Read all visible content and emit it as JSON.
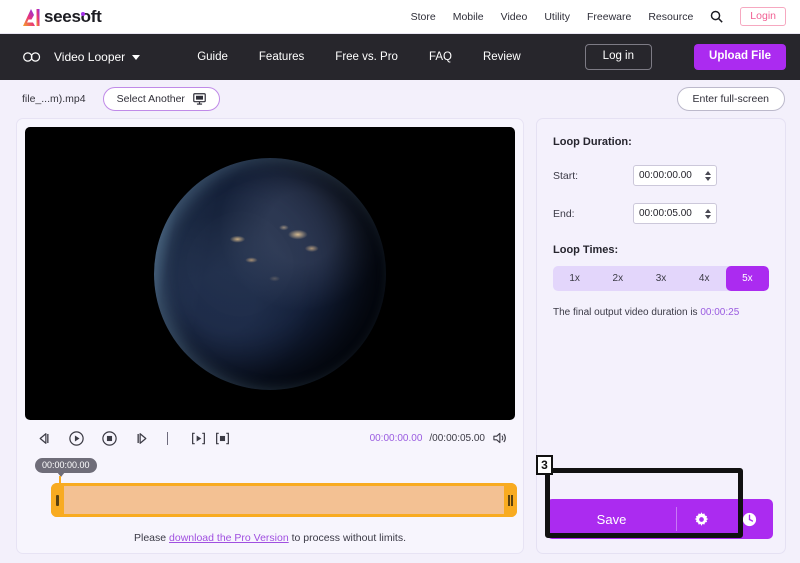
{
  "topbar": {
    "logo_text": "seesoft",
    "nav": [
      {
        "label": "Store"
      },
      {
        "label": "Mobile"
      },
      {
        "label": "Video"
      },
      {
        "label": "Utility"
      },
      {
        "label": "Freeware"
      },
      {
        "label": "Resource"
      }
    ],
    "search_icon": "search-icon",
    "login_label": "Login"
  },
  "darknav": {
    "loop_icon": "loop-icon",
    "product": "Video Looper",
    "links": [
      {
        "label": "Guide"
      },
      {
        "label": "Features"
      },
      {
        "label": "Free vs. Pro"
      },
      {
        "label": "FAQ"
      },
      {
        "label": "Review"
      }
    ],
    "login_label": "Log in",
    "upload_label": "Upload File"
  },
  "filerow": {
    "filename": "file_...m).mp4",
    "select_another_label": "Select Another",
    "monitor_icon": "monitor-icon",
    "fullscreen_label": "Enter full-screen"
  },
  "player": {
    "controls": [
      {
        "name": "rewind-button",
        "glyph": "rewind"
      },
      {
        "name": "play-button",
        "glyph": "play"
      },
      {
        "name": "stop-button",
        "glyph": "stop"
      },
      {
        "name": "fast-forward-button",
        "glyph": "forward"
      }
    ],
    "bracket_controls": [
      {
        "name": "set-start-marker-button",
        "glyph": "bracket-play"
      },
      {
        "name": "set-end-marker-button",
        "glyph": "bracket-stop"
      }
    ],
    "current_time": "00:00:00.00",
    "total_time": "/00:00:05.00",
    "volume_icon": "volume-icon",
    "timeline_tooltip": "00:00:00.00"
  },
  "pro_note": {
    "prefix": "Please ",
    "link": "download the Pro Version",
    "suffix": " to process without limits."
  },
  "panel": {
    "loop_duration_title": "Loop Duration:",
    "start_label": "Start:",
    "start_value": "00:00:00.00",
    "end_label": "End:",
    "end_value": "00:00:05.00",
    "loop_times_title": "Loop Times:",
    "loop_options": [
      {
        "label": "1x",
        "selected": false
      },
      {
        "label": "2x",
        "selected": false
      },
      {
        "label": "3x",
        "selected": false
      },
      {
        "label": "4x",
        "selected": false
      },
      {
        "label": "5x",
        "selected": true
      }
    ],
    "final_prefix": "The final output video duration is ",
    "final_value": "00:00:25",
    "save_label": "Save",
    "settings_icon": "gear-icon",
    "history_icon": "clock-icon"
  },
  "annotation": {
    "step_number": "3"
  },
  "colors": {
    "accent_purple": "#ab2bf0",
    "link_purple": "#9a5ce0",
    "pink": "#f15f93",
    "timeline_orange": "#f8ab21",
    "dark_nav": "#27262c",
    "page_bg": "#f3f0fb"
  }
}
